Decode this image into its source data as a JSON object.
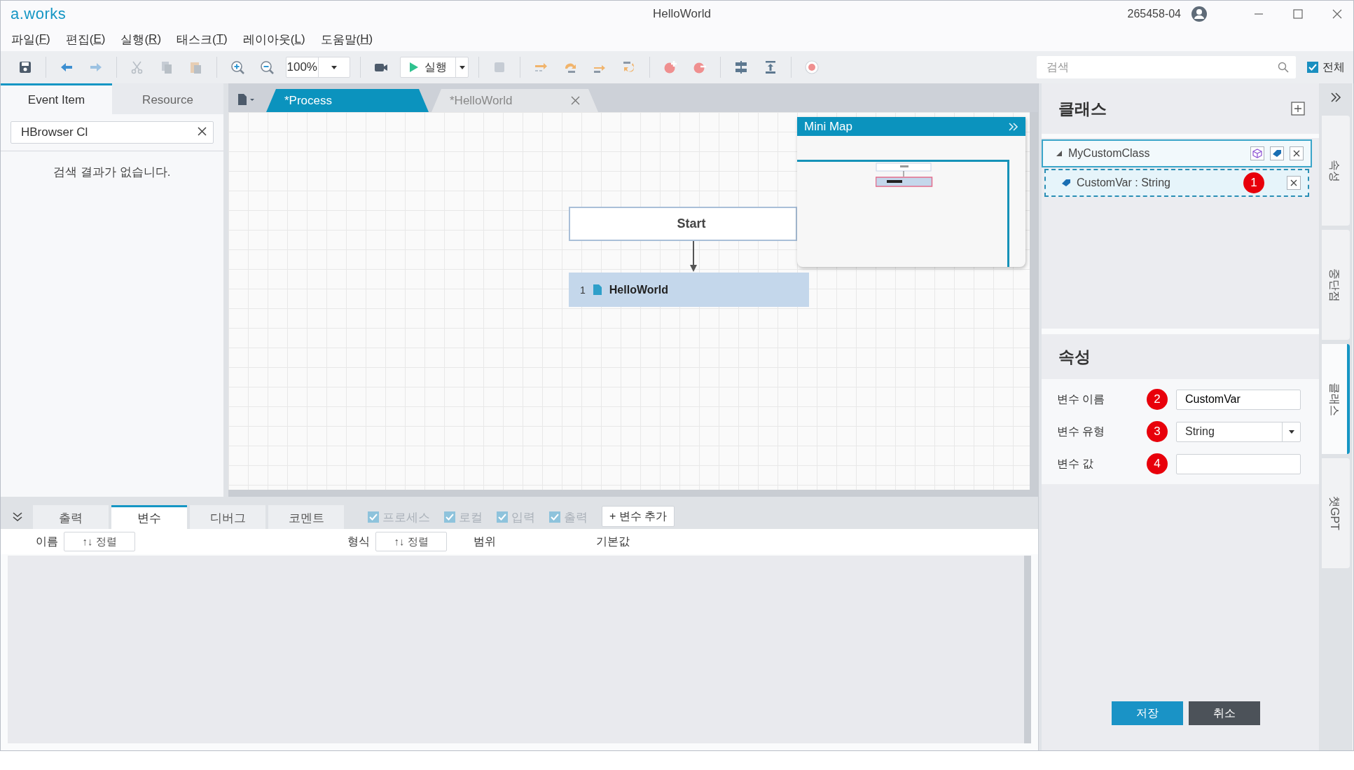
{
  "app": {
    "logo": "a.works",
    "title": "HelloWorld",
    "user": "265458-04"
  },
  "menu": [
    {
      "label": "파일(F)"
    },
    {
      "label": "편집(E)"
    },
    {
      "label": "실행(R)"
    },
    {
      "label": "태스크(T)"
    },
    {
      "label": "레이아웃(L)"
    },
    {
      "label": "도움말(H)"
    }
  ],
  "toolbar": {
    "groups": [
      [
        {
          "kind": "save",
          "disabled": false
        }
      ],
      [
        {
          "kind": "back",
          "disabled": false
        },
        {
          "kind": "forward",
          "disabled": true
        }
      ],
      [
        {
          "kind": "cut",
          "disabled": true
        },
        {
          "kind": "copy",
          "disabled": true
        },
        {
          "kind": "paste",
          "disabled": true
        }
      ],
      [
        {
          "kind": "zoom_in",
          "disabled": false
        },
        {
          "kind": "zoom_out",
          "disabled": false
        },
        {
          "kind": "zoom",
          "value": "100%",
          "disabled": false
        }
      ],
      [
        {
          "kind": "camera",
          "disabled": false
        },
        {
          "kind": "run",
          "label": "실행",
          "disabled": false
        }
      ],
      [
        {
          "kind": "stop",
          "disabled": true
        }
      ],
      [
        {
          "kind": "step_over",
          "disabled": false
        },
        {
          "kind": "step_into",
          "disabled": false
        },
        {
          "kind": "step_out",
          "disabled": false
        },
        {
          "kind": "step_back",
          "disabled": false
        }
      ],
      [
        {
          "kind": "bp_add",
          "disabled": false
        },
        {
          "kind": "bp_remove",
          "disabled": false
        }
      ],
      [
        {
          "kind": "align_middle",
          "disabled": false
        },
        {
          "kind": "align_top",
          "disabled": false
        }
      ],
      [
        {
          "kind": "record",
          "disabled": false
        }
      ]
    ],
    "search": {
      "placeholder": "검색"
    },
    "scope": {
      "label": "전체",
      "checked": true
    }
  },
  "left_panel": {
    "tabs": [
      {
        "label": "Event Item",
        "selected": true
      },
      {
        "label": "Resource",
        "selected": false
      }
    ],
    "search": {
      "value": "HBrowser Cl"
    },
    "empty_message": "검색 결과가 없습니다."
  },
  "editor": {
    "tabs": [
      {
        "label": "*Process",
        "selected": true,
        "closable": false
      },
      {
        "label": "*HelloWorld",
        "selected": false,
        "closable": true
      }
    ],
    "nodes": [
      {
        "kind": "start",
        "label": "Start"
      },
      {
        "kind": "activity",
        "number": "1",
        "label": "HelloWorld"
      }
    ],
    "minimap": {
      "title": "Mini Map"
    }
  },
  "bottom_panel": {
    "tabs": [
      {
        "label": "출력",
        "selected": false
      },
      {
        "label": "변수",
        "selected": true
      },
      {
        "label": "디버그",
        "selected": false
      },
      {
        "label": "코멘트",
        "selected": false
      }
    ],
    "filters": [
      {
        "label": "프로세스",
        "checked": true,
        "disabled": true
      },
      {
        "label": "로컬",
        "checked": true,
        "disabled": true
      },
      {
        "label": "입력",
        "checked": true,
        "disabled": true
      },
      {
        "label": "출력",
        "checked": true,
        "disabled": true
      }
    ],
    "add_button": "+ 변수 추가",
    "columns": [
      {
        "label": "이름",
        "sort": "↑↓ 정렬"
      },
      {
        "label": "형식",
        "sort": "↑↓ 정렬"
      },
      {
        "label": "범위"
      },
      {
        "label": "기본값"
      }
    ]
  },
  "class_panel": {
    "title": "클래스",
    "tree": [
      {
        "label": "MyCustomClass",
        "expanded": true,
        "selected": true,
        "children": [
          {
            "label": "CustomVar : String",
            "selected": true,
            "badge": "1"
          }
        ]
      }
    ]
  },
  "properties": {
    "title": "속성",
    "fields": [
      {
        "label": "변수 이름",
        "badge": "2",
        "kind": "text",
        "value": "CustomVar"
      },
      {
        "label": "변수 유형",
        "badge": "3",
        "kind": "select",
        "value": "String"
      },
      {
        "label": "변수 값",
        "badge": "4",
        "kind": "text"
      }
    ],
    "buttons": [
      {
        "label": "저장",
        "kind": "primary"
      },
      {
        "label": "취소",
        "kind": "secondary"
      }
    ]
  },
  "side_tabs": [
    {
      "label": "속성",
      "selected": false
    },
    {
      "label": "중단점",
      "selected": false
    },
    {
      "label": "클래스",
      "selected": true
    },
    {
      "label": "챗GPT",
      "selected": false
    }
  ]
}
